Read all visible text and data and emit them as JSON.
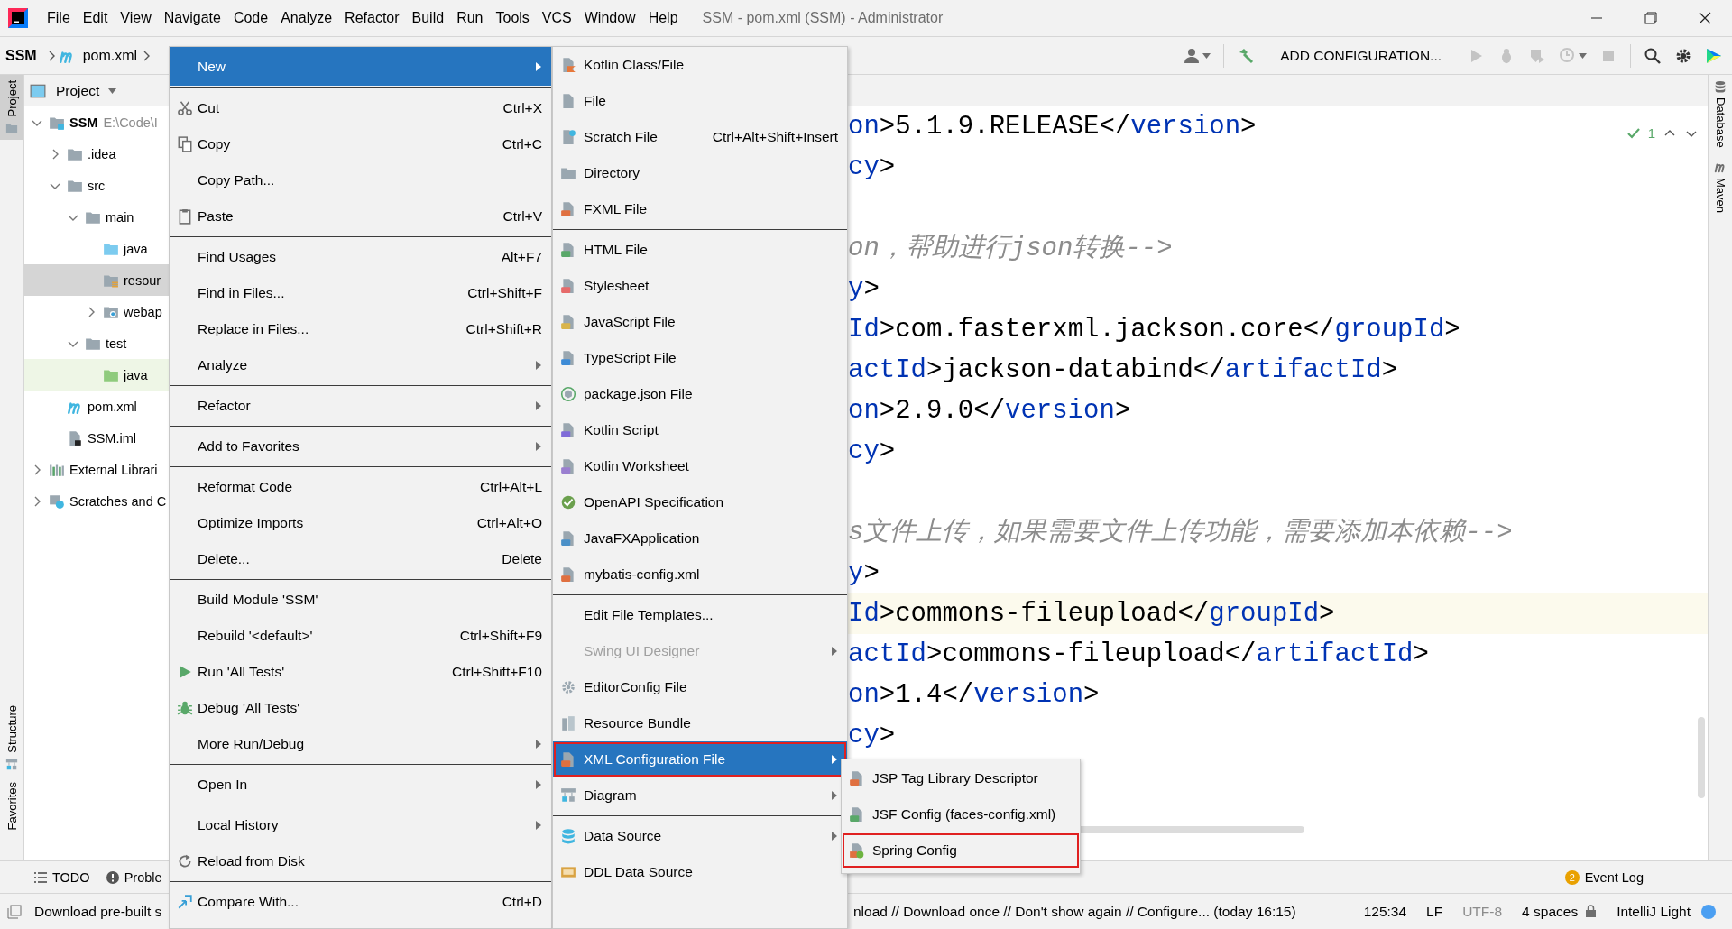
{
  "window": {
    "title": "SSM - pom.xml (SSM) - Administrator"
  },
  "menu_bar": [
    "File",
    "Edit",
    "View",
    "Navigate",
    "Code",
    "Analyze",
    "Refactor",
    "Build",
    "Run",
    "Tools",
    "VCS",
    "Window",
    "Help"
  ],
  "breadcrumbs": [
    {
      "label": "SSM",
      "kind": "module"
    },
    {
      "label": "pom.xml",
      "kind": "maven"
    }
  ],
  "toolbar": {
    "run_configuration": "ADD CONFIGURATION..."
  },
  "left_strip": [
    {
      "label": "Project",
      "selected": true
    },
    {
      "label": "Structure",
      "selected": false
    },
    {
      "label": "Favorites",
      "selected": false
    }
  ],
  "right_strip": [
    "Database",
    "Maven"
  ],
  "project": {
    "title": "Project",
    "tree": [
      {
        "label": "SSM",
        "secondary": "E:\\Code\\I",
        "kind": "module",
        "expanded": true,
        "selected": false,
        "highlighted": false,
        "children": [
          {
            "label": ".idea",
            "kind": "folder",
            "expanded": false,
            "selected": false,
            "highlighted": false
          },
          {
            "label": "src",
            "kind": "folder",
            "expanded": true,
            "selected": false,
            "highlighted": false,
            "children": [
              {
                "label": "main",
                "kind": "folder",
                "expanded": true,
                "selected": false,
                "highlighted": false,
                "children": [
                  {
                    "label": "java",
                    "kind": "source-folder",
                    "selected": false,
                    "highlighted": false
                  },
                  {
                    "label": "resour",
                    "kind": "resources-folder",
                    "selected": true,
                    "highlighted": false
                  },
                  {
                    "label": "webap",
                    "kind": "web-folder",
                    "expanded": false,
                    "selected": false,
                    "highlighted": false
                  }
                ]
              },
              {
                "label": "test",
                "kind": "folder",
                "expanded": true,
                "selected": false,
                "highlighted": false,
                "children": [
                  {
                    "label": "java",
                    "kind": "test-folder",
                    "selected": false,
                    "highlighted": true
                  }
                ]
              }
            ]
          },
          {
            "label": "pom.xml",
            "kind": "maven",
            "selected": false,
            "highlighted": false
          },
          {
            "label": "SSM.iml",
            "kind": "iml",
            "selected": false,
            "highlighted": false
          }
        ]
      },
      {
        "label": "External Librari",
        "kind": "libraries",
        "expanded": false,
        "selected": false,
        "highlighted": false
      },
      {
        "label": "Scratches and C",
        "kind": "scratches",
        "expanded": false,
        "selected": false,
        "highlighted": false
      }
    ]
  },
  "editor": {
    "inspection_count": "1",
    "lines": [
      {
        "kind": "code",
        "highlighted": false,
        "segments": [
          {
            "kind": "tag",
            "text": "on"
          },
          {
            "kind": "text",
            "text": ">5.1.9.RELEASE</"
          },
          {
            "kind": "tag",
            "text": "version"
          },
          {
            "kind": "text",
            "text": ">"
          }
        ]
      },
      {
        "kind": "code",
        "highlighted": false,
        "segments": [
          {
            "kind": "tag",
            "text": "cy"
          },
          {
            "kind": "text",
            "text": ">"
          }
        ]
      },
      {
        "kind": "blank",
        "highlighted": false
      },
      {
        "kind": "code",
        "highlighted": false,
        "segments": [
          {
            "kind": "comment",
            "text": "on，帮助进行json转换-->"
          }
        ]
      },
      {
        "kind": "code",
        "highlighted": false,
        "segments": [
          {
            "kind": "tag",
            "text": "y"
          },
          {
            "kind": "text",
            "text": ">"
          }
        ]
      },
      {
        "kind": "code",
        "highlighted": false,
        "segments": [
          {
            "kind": "tag",
            "text": "Id"
          },
          {
            "kind": "text",
            "text": ">com.fasterxml.jackson.core</"
          },
          {
            "kind": "tag",
            "text": "groupId"
          },
          {
            "kind": "text",
            "text": ">"
          }
        ]
      },
      {
        "kind": "code",
        "highlighted": false,
        "segments": [
          {
            "kind": "tag",
            "text": "actId"
          },
          {
            "kind": "text",
            "text": ">jackson-databind</"
          },
          {
            "kind": "tag",
            "text": "artifactId"
          },
          {
            "kind": "text",
            "text": ">"
          }
        ]
      },
      {
        "kind": "code",
        "highlighted": false,
        "segments": [
          {
            "kind": "tag",
            "text": "on"
          },
          {
            "kind": "text",
            "text": ">2.9.0</"
          },
          {
            "kind": "tag",
            "text": "version"
          },
          {
            "kind": "text",
            "text": ">"
          }
        ]
      },
      {
        "kind": "code",
        "highlighted": false,
        "segments": [
          {
            "kind": "tag",
            "text": "cy"
          },
          {
            "kind": "text",
            "text": ">"
          }
        ]
      },
      {
        "kind": "blank",
        "highlighted": false
      },
      {
        "kind": "code",
        "highlighted": false,
        "segments": [
          {
            "kind": "comment",
            "text": "s文件上传，如果需要文件上传功能，需要添加本依赖-->"
          }
        ]
      },
      {
        "kind": "code",
        "highlighted": false,
        "segments": [
          {
            "kind": "tag",
            "text": "y"
          },
          {
            "kind": "text",
            "text": ">"
          }
        ]
      },
      {
        "kind": "code",
        "highlighted": true,
        "segments": [
          {
            "kind": "tag",
            "text": "Id"
          },
          {
            "kind": "text",
            "text": ">commons-fileupload</"
          },
          {
            "kind": "tag",
            "text": "groupId"
          },
          {
            "kind": "text",
            "text": ">"
          }
        ]
      },
      {
        "kind": "code",
        "highlighted": false,
        "segments": [
          {
            "kind": "tag",
            "text": "actId"
          },
          {
            "kind": "text",
            "text": ">commons-fileupload</"
          },
          {
            "kind": "tag",
            "text": "artifactId"
          },
          {
            "kind": "text",
            "text": ">"
          }
        ]
      },
      {
        "kind": "code",
        "highlighted": false,
        "segments": [
          {
            "kind": "tag",
            "text": "on"
          },
          {
            "kind": "text",
            "text": ">1.4</"
          },
          {
            "kind": "tag",
            "text": "version"
          },
          {
            "kind": "text",
            "text": ">"
          }
        ]
      },
      {
        "kind": "code",
        "highlighted": false,
        "segments": [
          {
            "kind": "tag",
            "text": "cy"
          },
          {
            "kind": "text",
            "text": ">"
          }
        ]
      }
    ]
  },
  "context_menu": {
    "items": [
      {
        "kind": "item",
        "label": "New",
        "submenu": true,
        "selected": true
      },
      {
        "kind": "separator"
      },
      {
        "kind": "item",
        "label": "Cut",
        "shortcut": "Ctrl+X",
        "submenu": false,
        "selected": false
      },
      {
        "kind": "item",
        "label": "Copy",
        "shortcut": "Ctrl+C",
        "submenu": false,
        "selected": false
      },
      {
        "kind": "item",
        "label": "Copy Path...",
        "submenu": false,
        "selected": false
      },
      {
        "kind": "item",
        "label": "Paste",
        "shortcut": "Ctrl+V",
        "submenu": false,
        "selected": false
      },
      {
        "kind": "separator"
      },
      {
        "kind": "item",
        "label": "Find Usages",
        "shortcut": "Alt+F7",
        "submenu": false,
        "selected": false
      },
      {
        "kind": "item",
        "label": "Find in Files...",
        "shortcut": "Ctrl+Shift+F",
        "submenu": false,
        "selected": false
      },
      {
        "kind": "item",
        "label": "Replace in Files...",
        "shortcut": "Ctrl+Shift+R",
        "submenu": false,
        "selected": false
      },
      {
        "kind": "item",
        "label": "Analyze",
        "submenu": true,
        "selected": false
      },
      {
        "kind": "separator"
      },
      {
        "kind": "item",
        "label": "Refactor",
        "submenu": true,
        "selected": false
      },
      {
        "kind": "separator"
      },
      {
        "kind": "item",
        "label": "Add to Favorites",
        "submenu": true,
        "selected": false
      },
      {
        "kind": "separator"
      },
      {
        "kind": "item",
        "label": "Reformat Code",
        "shortcut": "Ctrl+Alt+L",
        "submenu": false,
        "selected": false
      },
      {
        "kind": "item",
        "label": "Optimize Imports",
        "shortcut": "Ctrl+Alt+O",
        "submenu": false,
        "selected": false
      },
      {
        "kind": "item",
        "label": "Delete...",
        "shortcut": "Delete",
        "submenu": false,
        "selected": false
      },
      {
        "kind": "separator"
      },
      {
        "kind": "item",
        "label": "Build Module 'SSM'",
        "submenu": false,
        "selected": false
      },
      {
        "kind": "item",
        "label": "Rebuild '<default>'",
        "shortcut": "Ctrl+Shift+F9",
        "submenu": false,
        "selected": false
      },
      {
        "kind": "item",
        "label": "Run 'All Tests'",
        "shortcut": "Ctrl+Shift+F10",
        "submenu": false,
        "selected": false
      },
      {
        "kind": "item",
        "label": "Debug 'All Tests'",
        "submenu": false,
        "selected": false
      },
      {
        "kind": "item",
        "label": "More Run/Debug",
        "submenu": true,
        "selected": false
      },
      {
        "kind": "separator"
      },
      {
        "kind": "item",
        "label": "Open In",
        "submenu": true,
        "selected": false
      },
      {
        "kind": "separator"
      },
      {
        "kind": "item",
        "label": "Local History",
        "submenu": true,
        "selected": false
      },
      {
        "kind": "item",
        "label": "Reload from Disk",
        "submenu": false,
        "selected": false
      },
      {
        "kind": "separator"
      },
      {
        "kind": "item",
        "label": "Compare With...",
        "shortcut": "Ctrl+D",
        "submenu": false,
        "selected": false
      }
    ]
  },
  "new_submenu": {
    "items": [
      {
        "kind": "item",
        "label": "Kotlin Class/File",
        "submenu": false,
        "selected": false,
        "disabled": false,
        "outlined": false
      },
      {
        "kind": "item",
        "label": "File",
        "submenu": false,
        "selected": false,
        "disabled": false,
        "outlined": false
      },
      {
        "kind": "item",
        "label": "Scratch File",
        "shortcut": "Ctrl+Alt+Shift+Insert",
        "submenu": false,
        "selected": false,
        "disabled": false,
        "outlined": false
      },
      {
        "kind": "item",
        "label": "Directory",
        "submenu": false,
        "selected": false,
        "disabled": false,
        "outlined": false
      },
      {
        "kind": "item",
        "label": "FXML File",
        "submenu": false,
        "selected": false,
        "disabled": false,
        "outlined": false
      },
      {
        "kind": "separator"
      },
      {
        "kind": "item",
        "label": "HTML File",
        "submenu": false,
        "selected": false,
        "disabled": false,
        "outlined": false
      },
      {
        "kind": "item",
        "label": "Stylesheet",
        "submenu": false,
        "selected": false,
        "disabled": false,
        "outlined": false
      },
      {
        "kind": "item",
        "label": "JavaScript File",
        "submenu": false,
        "selected": false,
        "disabled": false,
        "outlined": false
      },
      {
        "kind": "item",
        "label": "TypeScript File",
        "submenu": false,
        "selected": false,
        "disabled": false,
        "outlined": false
      },
      {
        "kind": "item",
        "label": "package.json File",
        "submenu": false,
        "selected": false,
        "disabled": false,
        "outlined": false
      },
      {
        "kind": "item",
        "label": "Kotlin Script",
        "submenu": false,
        "selected": false,
        "disabled": false,
        "outlined": false
      },
      {
        "kind": "item",
        "label": "Kotlin Worksheet",
        "submenu": false,
        "selected": false,
        "disabled": false,
        "outlined": false
      },
      {
        "kind": "item",
        "label": "OpenAPI Specification",
        "submenu": false,
        "selected": false,
        "disabled": false,
        "outlined": false
      },
      {
        "kind": "item",
        "label": "JavaFXApplication",
        "submenu": false,
        "selected": false,
        "disabled": false,
        "outlined": false
      },
      {
        "kind": "item",
        "label": "mybatis-config.xml",
        "submenu": false,
        "selected": false,
        "disabled": false,
        "outlined": false
      },
      {
        "kind": "separator"
      },
      {
        "kind": "item",
        "label": "Edit File Templates...",
        "submenu": false,
        "selected": false,
        "disabled": false,
        "outlined": false
      },
      {
        "kind": "item",
        "label": "Swing UI Designer",
        "submenu": true,
        "selected": false,
        "disabled": true,
        "outlined": false
      },
      {
        "kind": "item",
        "label": "EditorConfig File",
        "submenu": false,
        "selected": false,
        "disabled": false,
        "outlined": false
      },
      {
        "kind": "item",
        "label": "Resource Bundle",
        "submenu": false,
        "selected": false,
        "disabled": false,
        "outlined": false
      },
      {
        "kind": "item",
        "label": "XML Configuration File",
        "submenu": true,
        "selected": true,
        "disabled": false,
        "outlined": true
      },
      {
        "kind": "item",
        "label": "Diagram",
        "submenu": true,
        "selected": false,
        "disabled": false,
        "outlined": false
      },
      {
        "kind": "separator"
      },
      {
        "kind": "item",
        "label": "Data Source",
        "submenu": true,
        "selected": false,
        "disabled": false,
        "outlined": false
      },
      {
        "kind": "item",
        "label": "DDL Data Source",
        "submenu": false,
        "selected": false,
        "disabled": false,
        "outlined": false
      }
    ]
  },
  "xml_submenu": {
    "items": [
      {
        "kind": "item",
        "label": "JSP Tag Library Descriptor",
        "submenu": false,
        "selected": false,
        "outlined": false
      },
      {
        "kind": "item",
        "label": "JSF Config (faces-config.xml)",
        "submenu": false,
        "selected": false,
        "outlined": false
      },
      {
        "kind": "item",
        "label": "Spring Config",
        "submenu": false,
        "selected": false,
        "outlined": true
      }
    ]
  },
  "tool_windows": [
    "TODO",
    "Proble"
  ],
  "event_log": {
    "count": "2",
    "label": "Event Log"
  },
  "status_bar": {
    "message_left": "Download pre-built s",
    "message_right": "nload // Download once // Don't show again // Configure... (today 16:15)",
    "position": "125:34",
    "line_separator": "LF",
    "encoding": "UTF-8",
    "indent": "4 spaces",
    "theme": "IntelliJ Light"
  }
}
